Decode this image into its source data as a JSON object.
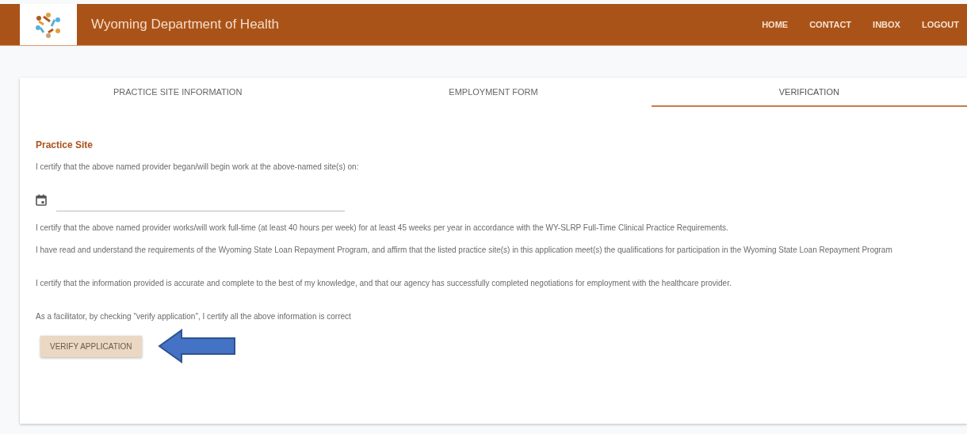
{
  "header": {
    "title": "Wyoming Department of Health",
    "nav": [
      "HOME",
      "CONTACT",
      "INBOX",
      "LOGOUT"
    ]
  },
  "tabs": [
    {
      "label": "PRACTICE SITE INFORMATION",
      "selected": false
    },
    {
      "label": "EMPLOYMENT FORM",
      "selected": false
    },
    {
      "label": "VERIFICATION",
      "selected": true
    }
  ],
  "section_title": "Practice Site",
  "start_statement": "I certify that the above named provider began/will begin work at the above-named site(s) on:",
  "statements": [
    "I certify that the above named provider works/will work full-time (at least 40 hours per week) for at least 45 weeks per year in accordance with the WY-SLRP Full-Time Clinical Practice Requirements.",
    "I have read and understand the requirements of the Wyoming State Loan Repayment Program, and affirm that the listed practice site(s) in this application meet(s) the qualifications for participation in the Wyoming State Loan Repayment Program",
    "I certify that the information provided is accurate and complete to the best of my knowledge, and that our agency has successfully completed negotiations for employment with the healthcare provider."
  ],
  "facilitator_note": "As a facilitator, by checking \"verify application\", I certify all the above information is correct",
  "verify_button": "VERIFY APPLICATION"
}
